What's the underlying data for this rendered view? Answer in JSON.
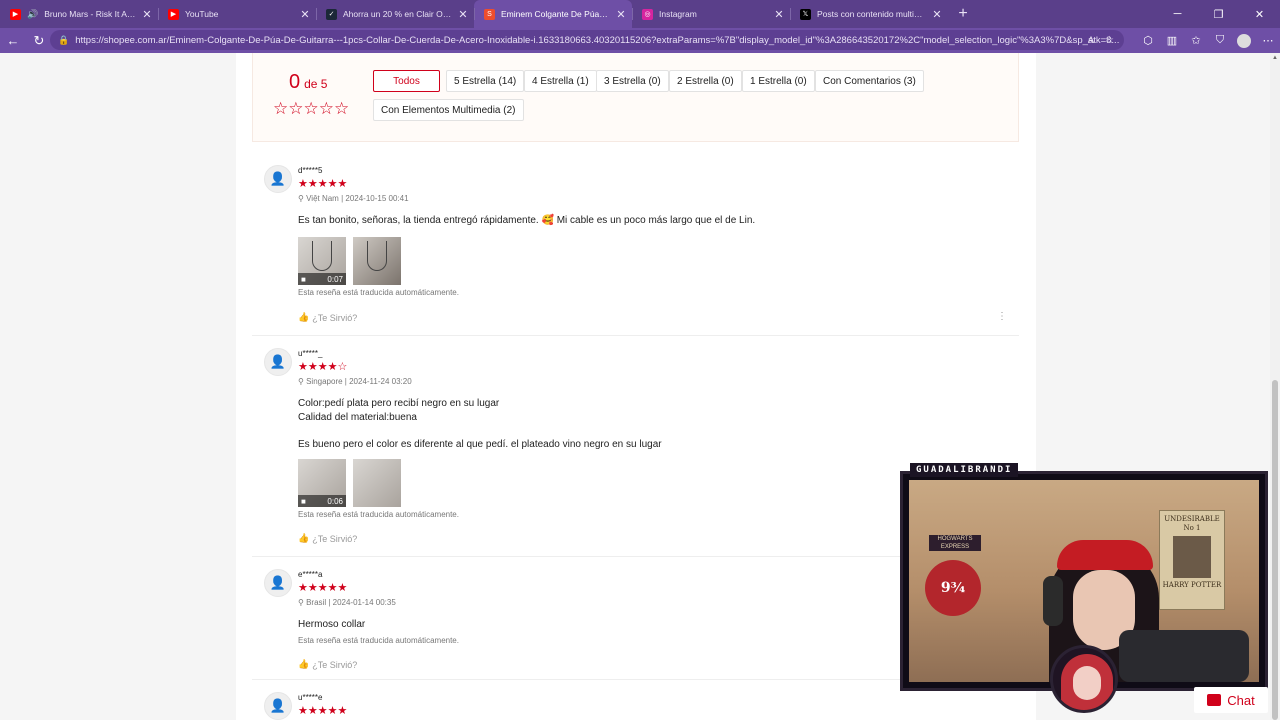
{
  "browser": {
    "tabs": [
      {
        "title": "Bruno Mars - Risk It All [Offici",
        "favicon_color": "#ff0000",
        "audio": true,
        "active": false
      },
      {
        "title": "YouTube",
        "favicon_color": "#ff0000",
        "audio": false,
        "active": false
      },
      {
        "title": "Ahorra un 20 % en Clair Obscur: E",
        "favicon_color": "#1b2838",
        "audio": false,
        "active": false
      },
      {
        "title": "Eminem Colgante De Púa De Guita",
        "favicon_color": "#ee4d2d",
        "audio": false,
        "active": true
      },
      {
        "title": "Instagram",
        "favicon_color": "#d6249f",
        "audio": false,
        "active": false
      },
      {
        "title": "Posts con contenido multimedia d",
        "favicon_color": "#000000",
        "audio": false,
        "active": false
      }
    ],
    "url": "https://shopee.com.ar/Eminem-Colgante-De-Púa-De-Guitarra---1pcs-Collar-De-Cuerda-De-Acero-Inoxidable-i.1633180663.40320115206?extraParams=%7B\"display_model_id\"%3A286643520172%2C\"model_selection_logic\"%3A3%7D&sp_atk=8...",
    "address_aa": "A",
    "accent": "#6e4fa6"
  },
  "rating": {
    "score": "0",
    "out_of": "de 5",
    "empty_stars": "☆☆☆☆☆",
    "filters": [
      {
        "label": "Todos",
        "selected": true
      },
      {
        "label": "5 Estrella (14)",
        "selected": false
      },
      {
        "label": "4 Estrella (1)",
        "selected": false
      },
      {
        "label": "3 Estrella (0)",
        "selected": false
      },
      {
        "label": "2 Estrella (0)",
        "selected": false
      },
      {
        "label": "1 Estrella (0)",
        "selected": false
      },
      {
        "label": "Con Comentarios (3)",
        "selected": false
      },
      {
        "label": "Con Elementos Multimedia (2)",
        "selected": false
      }
    ]
  },
  "reviews": [
    {
      "user": "d*****5",
      "stars": "★★★★★",
      "meta": "Việt Nam | 2024-10-15 00:41",
      "text": [
        "Es tan bonito, señoras, la tienda entregó rápidamente. 🥰 Mi cable es un poco más largo que el de Lin."
      ],
      "video_duration": "0:07",
      "auto_note": "Esta reseña está traducida automáticamente.",
      "helpful": "¿Te Sirvió?"
    },
    {
      "user": "u*****_",
      "stars": "★★★★☆",
      "meta": "Singapore | 2024-11-24 03:20",
      "text": [
        "Color:pedí plata pero recibí negro en su lugar",
        "Calidad del material:buena",
        "",
        "Es bueno pero el color es diferente al que pedí. el plateado vino negro en su lugar"
      ],
      "video_duration": "0:06",
      "auto_note": "Esta reseña está traducida automáticamente.",
      "helpful": "¿Te Sirvió?"
    },
    {
      "user": "e*****a",
      "stars": "★★★★★",
      "meta": "Brasil | 2024-01-14 00:35",
      "text": [
        "Hermoso collar"
      ],
      "auto_note": "Esta reseña está traducida automáticamente.",
      "helpful": "¿Te Sirvió?"
    },
    {
      "user": "u*****e",
      "stars": "★★★★★"
    }
  ],
  "stream_overlay": {
    "channel": "GUADALIBRANDI",
    "poster_title": "UNDESIRABLE",
    "poster_no": "No 1",
    "poster_name": "HARRY POTTER",
    "sign": "HOGWARTS EXPRESS",
    "platform": "9¾"
  },
  "chat": {
    "label": "Chat"
  }
}
